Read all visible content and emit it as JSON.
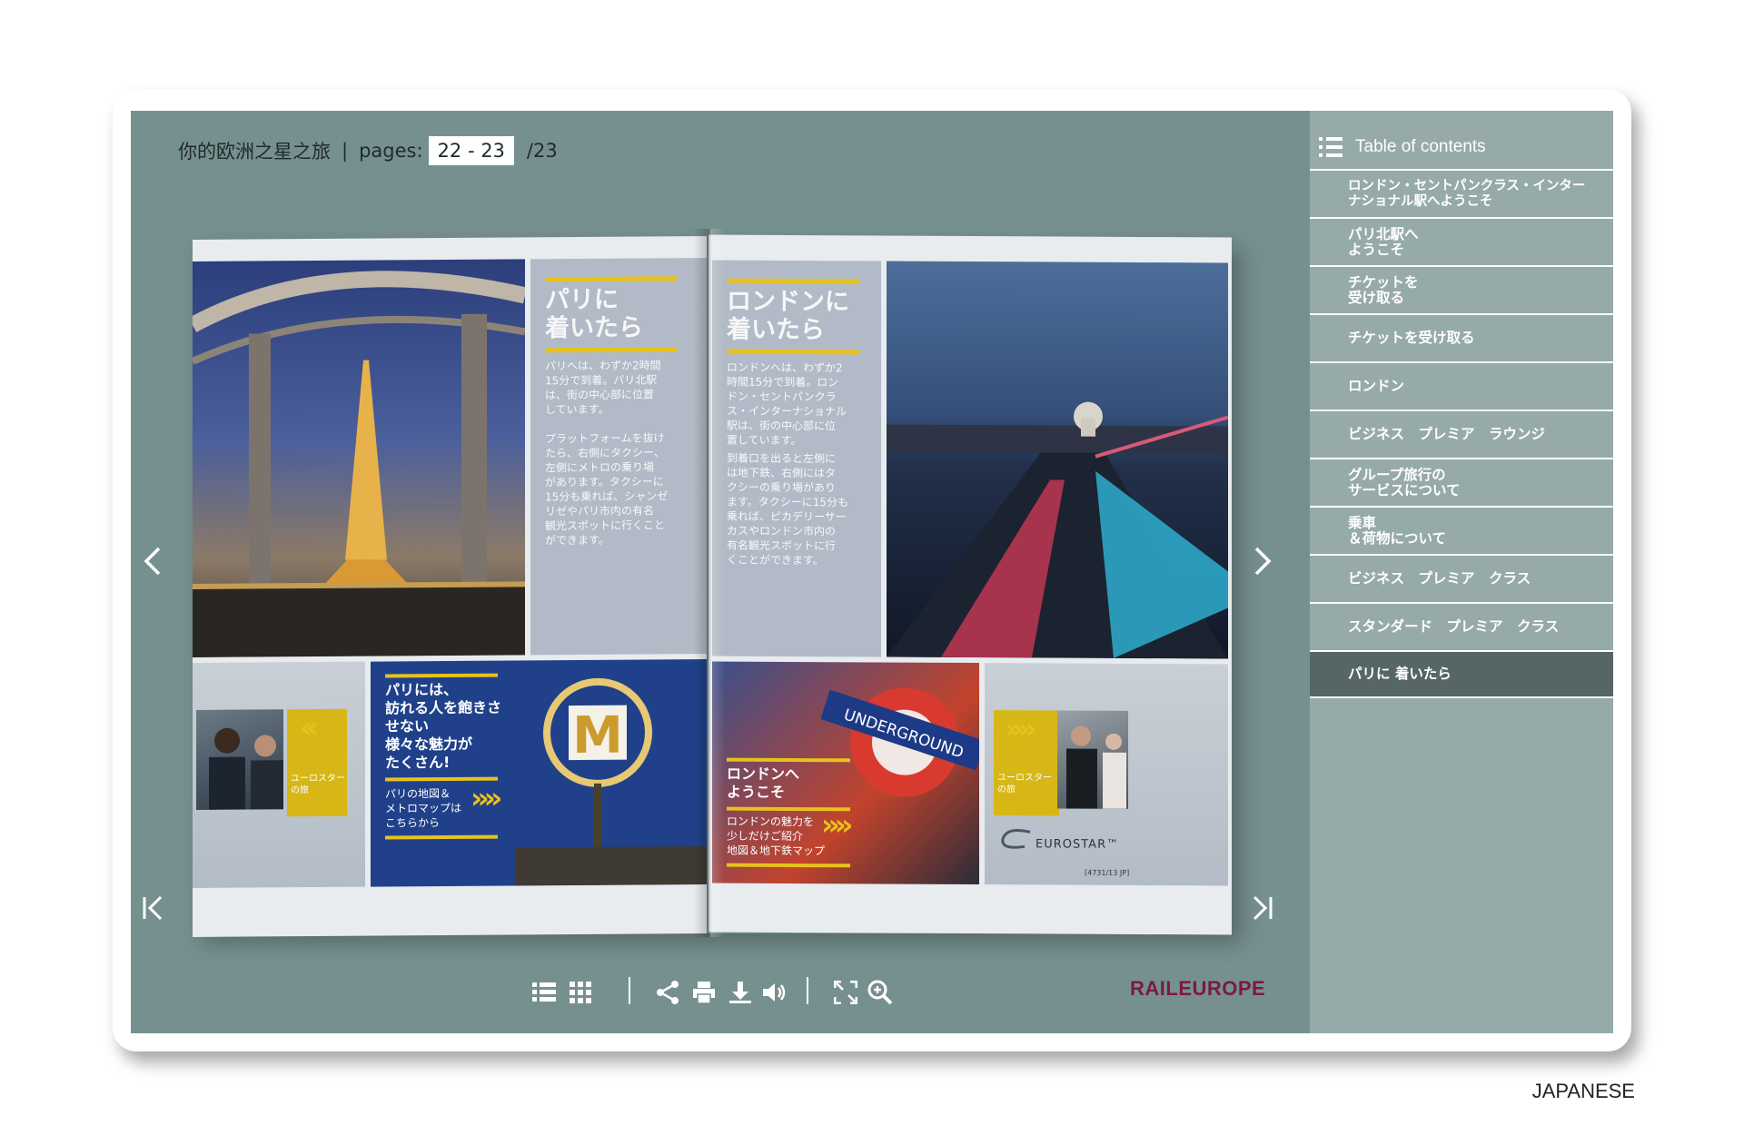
{
  "viewer": {
    "title": "你的欧洲之星之旅",
    "pages_label": "pages:",
    "current_pages": "22 - 23",
    "total_pages": "/23"
  },
  "toc": {
    "heading": "Table of contents",
    "items": [
      {
        "label": "ロンドン・セントパンクラス・インター\nナショナル駅へようこそ",
        "active": false
      },
      {
        "label": "パリ北駅へ\nようこそ",
        "active": false
      },
      {
        "label": "チケットを\n受け取る",
        "active": false
      },
      {
        "label": "チケットを受け取る",
        "active": false
      },
      {
        "label": "ロンドン",
        "active": false
      },
      {
        "label": "ビジネス　プレミア　ラウンジ",
        "active": false
      },
      {
        "label": "グループ旅行の\nサービスについて",
        "active": false
      },
      {
        "label": "乗車\n＆荷物について",
        "active": false
      },
      {
        "label": "ビジネス　プレミア　クラス",
        "active": false
      },
      {
        "label": "スタンダード　プレミア　クラス",
        "active": false
      },
      {
        "label": "パリに 着いたら",
        "active": true
      }
    ]
  },
  "book": {
    "left": {
      "heading": "パリに\n着いたら",
      "body1": "パリへは、わずか2時間\n15分で到着。パリ北駅\nは、街の中心部に位置\nしています。",
      "body2": "プラットフォームを抜け\nたら、右側にタクシー、\n左側にメトロの乗り場\nがあります。タクシーに\n15分も乗れば、シャンゼ\nリゼやパリ市内の有名\n観光スポットに行くこと\nができます。",
      "promo_big": "パリには、\n訪れる人を飽きさ\nせない\n様々な魅力が\nたくさん!",
      "promo_small": "パリの地図＆\nメトロマップは\nこちらから",
      "box_label": "ユーロスター\nの旅",
      "metro_sign": "M"
    },
    "right": {
      "heading": "ロンドンに\n着いたら",
      "body1": "ロンドンへは、わずか2\n時間15分で到着。ロン\nドン・セントパンクラ\nス・インターナショナル\n駅は、街の中心部に位\n置しています。",
      "body2": "到着口を出ると左側に\nは地下鉄、右側にはタ\nクシーの乗り場があり\nます。タクシーに15分も\n乗れば、ピカデリーサー\nカスやロンドン市内の\n有名観光スポットに行\nくことができます。",
      "promo_big": "ロンドンへ\nようこそ",
      "promo_small": "ロンドンの魅力を\n少しだけご紹介\n地図＆地下鉄マップ",
      "box_label": "ユーロスター\nの旅",
      "underground": "UNDERGROUND",
      "eurostar": "EUROSTAR™",
      "code": "[4731/13 JP]"
    }
  },
  "toolbar": {
    "icons": [
      "list-icon",
      "grid-icon",
      "share-icon",
      "print-icon",
      "download-icon",
      "sound-icon",
      "fullscreen-icon",
      "zoom-in-icon"
    ],
    "logo": "RAILEUROPE"
  },
  "footer": {
    "language": "JAPANESE"
  },
  "colors": {
    "viewer_bg": "#76908f",
    "toc_bg": "#96aaa9",
    "toc_active": "#556665",
    "accent_yellow": "#e7c21c",
    "brand": "#7a1b3f"
  }
}
